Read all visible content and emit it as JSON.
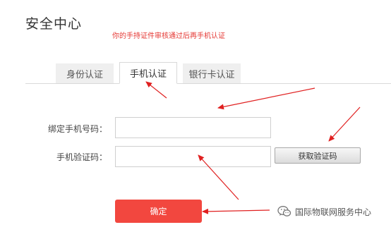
{
  "header": {
    "title": "安全中心",
    "notice": "你的手持证件审核通过后再手机认证"
  },
  "tabs": [
    {
      "label": "身份认证",
      "active": false
    },
    {
      "label": "手机认证",
      "active": true
    },
    {
      "label": "银行卡认证",
      "active": false
    }
  ],
  "form": {
    "phone_label": "绑定手机号码：",
    "phone_value": "",
    "code_label": "手机验证码：",
    "code_value": "",
    "get_code_label": "获取验证码",
    "confirm_label": "确定"
  },
  "watermark": {
    "icon": "wechat-icon",
    "text": "国际物联网服务中心"
  },
  "colors": {
    "accent": "#f2473f",
    "notice": "#e53935",
    "annotation": "#e02020"
  }
}
